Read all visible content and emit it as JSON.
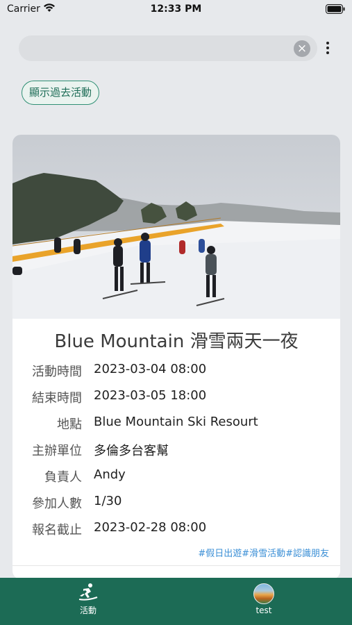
{
  "status_bar": {
    "carrier": "Carrier",
    "time": "12:33 PM"
  },
  "search": {
    "value": "",
    "placeholder": ""
  },
  "filter_chip": {
    "label": "顯示過去活動"
  },
  "event": {
    "title": "Blue Mountain 滑雪兩天一夜",
    "details": [
      {
        "label": "活動時間",
        "value": "2023-03-04 08:00"
      },
      {
        "label": "結束時間",
        "value": "2023-03-05 18:00"
      },
      {
        "label": "地點",
        "value": "Blue Mountain Ski Resourt"
      },
      {
        "label": "主辦單位",
        "value": "多倫多台客幫"
      },
      {
        "label": "負責人",
        "value": "Andy"
      },
      {
        "label": "參加人數",
        "value": "1/30"
      },
      {
        "label": "報名截止",
        "value": "2023-02-28 08:00"
      }
    ],
    "tags": "#假日出遊#滑雪活動#認識朋友"
  },
  "tab_bar": {
    "tabs": [
      {
        "label": "活動",
        "icon": "skiing-icon"
      },
      {
        "label": "test",
        "icon": "avatar"
      }
    ]
  }
}
